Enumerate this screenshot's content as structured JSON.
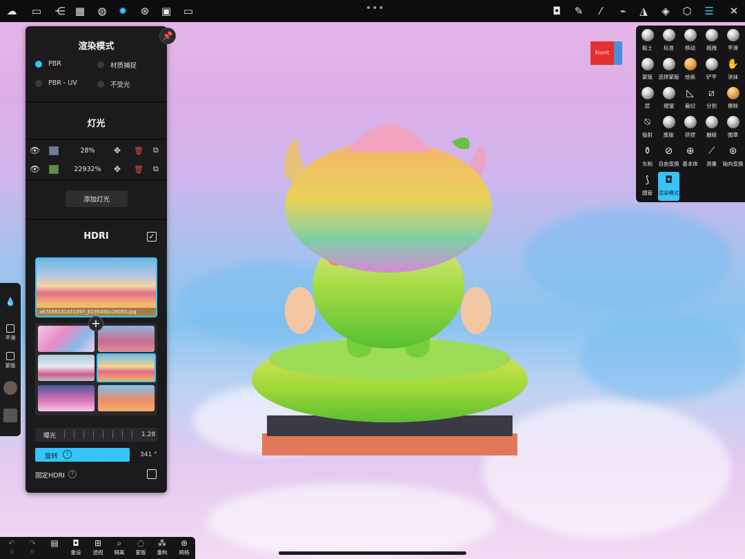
{
  "top_toolbar": {
    "left_icons": [
      "logo-icon",
      "folder-icon",
      "scene-graph-icon",
      "grid-icon",
      "sphere-icon",
      "sun-icon",
      "film-icon",
      "image-icon",
      "video-icon"
    ],
    "active_icon": "sun-icon",
    "more": "•••",
    "right_icons": [
      "camera-icon",
      "brush-icon",
      "stroke-icon",
      "shoe-icon",
      "symmetry-icon",
      "layers-icon",
      "hexagon-icon",
      "sliders-icon",
      "tools-icon"
    ]
  },
  "render_panel": {
    "pin_icon": "pin-icon",
    "render_mode_title": "渲染模式",
    "modes": [
      {
        "label": "PBR",
        "selected": true
      },
      {
        "label": "材质捕捉",
        "selected": false
      },
      {
        "label": "PBR - UV",
        "selected": false
      },
      {
        "label": "不受光",
        "selected": false
      }
    ],
    "lights_title": "灯光",
    "lights": [
      {
        "value": "28%",
        "color": "#6f7d96"
      },
      {
        "value": "22932%",
        "color": "#5f8f3f"
      }
    ],
    "add_light_label": "添加灯光",
    "hdri_title": "HDRI",
    "hdri_enabled": true,
    "hdri_filename": "a67b56131451397_619545bc26050.jpg",
    "add_symbol": "+",
    "exposure_label": "曝光",
    "exposure_value": "1.28",
    "rotation_label": "旋转",
    "rotation_value": "341 °",
    "help_symbol": "?",
    "fixed_hdri_label": "固定HDRI",
    "fixed_hdri_checked": false
  },
  "side_strip": {
    "items": [
      {
        "icon": "drop-icon",
        "label": ""
      },
      {
        "icon": "smooth-icon",
        "label": "平滑"
      },
      {
        "icon": "mask-icon",
        "label": "蒙版"
      }
    ]
  },
  "tools": [
    {
      "label": "黏土",
      "icon": "ball"
    },
    {
      "label": "标准",
      "icon": "ball"
    },
    {
      "label": "移动",
      "icon": "ball"
    },
    {
      "label": "拖拽",
      "icon": "ball"
    },
    {
      "label": "平滑",
      "icon": "ball"
    },
    {
      "label": "蒙版",
      "icon": "ball"
    },
    {
      "label": "选择蒙版",
      "icon": "ball"
    },
    {
      "label": "绘画",
      "icon": "ball-orange"
    },
    {
      "label": "铲平",
      "icon": "ball"
    },
    {
      "label": "涂抹",
      "icon": "hand-icon"
    },
    {
      "label": "层",
      "icon": "ball"
    },
    {
      "label": "褶皱",
      "icon": "ball"
    },
    {
      "label": "裁切",
      "icon": "knife-icon"
    },
    {
      "label": "分割",
      "icon": "split-icon"
    },
    {
      "label": "擦除",
      "icon": "ball-orange"
    },
    {
      "label": "投射",
      "icon": "project-icon"
    },
    {
      "label": "膨胀",
      "icon": "ball"
    },
    {
      "label": "挤捏",
      "icon": "ball"
    },
    {
      "label": "触碰",
      "icon": "ball"
    },
    {
      "label": "图章",
      "icon": "ball"
    },
    {
      "label": "车削",
      "icon": "lathe-icon"
    },
    {
      "label": "自由变换",
      "icon": "transform-icon"
    },
    {
      "label": "基本体",
      "icon": "primitive-icon"
    },
    {
      "label": "测量",
      "icon": "ruler-icon"
    },
    {
      "label": "轴向变换",
      "icon": "gizmo-icon"
    },
    {
      "label": "圆管",
      "icon": "tube-icon"
    },
    {
      "label": "渲染模式",
      "icon": "camera-icon",
      "active": true
    }
  ],
  "view_cube": {
    "face_label": "Front"
  },
  "bottom_toolbar": {
    "items": [
      {
        "icon": "undo-icon",
        "label": "↶",
        "count": "0"
      },
      {
        "icon": "redo-icon",
        "label": "↷",
        "count": "0"
      },
      {
        "icon": "doc-icon",
        "label": ""
      },
      {
        "icon": "reset-icon",
        "label": "重设"
      },
      {
        "icon": "perspective-icon",
        "label": "透视"
      },
      {
        "icon": "isolate-icon",
        "label": "隔离"
      },
      {
        "icon": "mask-view-icon",
        "label": "蒙版"
      },
      {
        "icon": "remesh-icon",
        "label": "重构"
      },
      {
        "icon": "mesh-icon",
        "label": "网格"
      }
    ]
  }
}
